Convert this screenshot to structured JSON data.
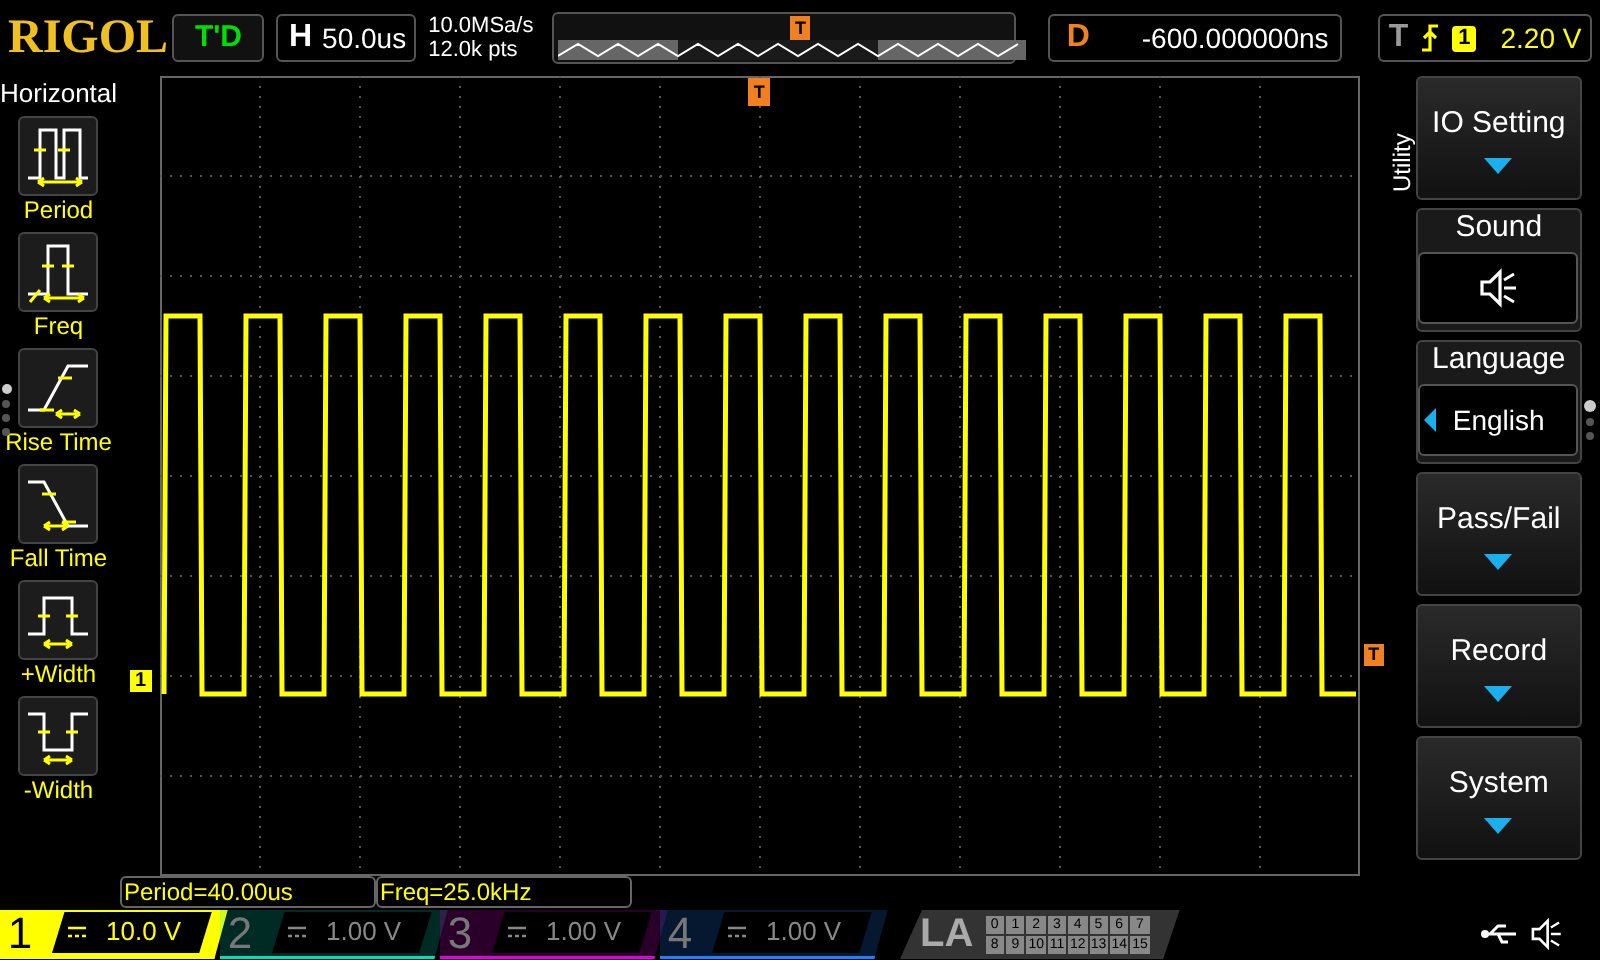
{
  "top_bar": {
    "logo": "RIGOL",
    "run_status": "T'D",
    "horizontal": {
      "label": "H",
      "value": "50.0us"
    },
    "sample_rate": "10.0MSa/s",
    "memory_depth": "12.0k pts",
    "trigger_position_marker": "T",
    "delay": {
      "label": "D",
      "value": "-600.000000ns"
    },
    "trigger": {
      "label": "T",
      "source": "1",
      "level": "2.20 V"
    }
  },
  "left_menu": {
    "title": "Horizontal",
    "items": [
      {
        "kind": "period",
        "label": "Period"
      },
      {
        "kind": "freq",
        "label": "Freq"
      },
      {
        "kind": "rise",
        "label": "Rise Time"
      },
      {
        "kind": "fall",
        "label": "Fall Time"
      },
      {
        "kind": "pwidth",
        "label": "+Width"
      },
      {
        "kind": "nwidth",
        "label": "-Width"
      }
    ],
    "pages": [
      {
        "selected": true
      },
      {
        "selected": false
      },
      {
        "selected": false
      },
      {
        "selected": false
      }
    ]
  },
  "waveform": {
    "channel_marker": "1",
    "trigger_marker_top": "T",
    "trigger_level_marker": "T"
  },
  "measurements": [
    "Period=40.00us",
    "Freq=25.0kHz"
  ],
  "right_menu": {
    "title": "Utility",
    "items": [
      {
        "kind": "submenu",
        "label": "IO Setting"
      },
      {
        "kind": "icon",
        "label": "Sound"
      },
      {
        "kind": "select",
        "label": "Language",
        "value": "English"
      },
      {
        "kind": "submenu",
        "label": "Pass/Fail"
      },
      {
        "kind": "submenu",
        "label": "Record"
      },
      {
        "kind": "submenu",
        "label": "System"
      }
    ],
    "pages": [
      {
        "selected": true
      },
      {
        "selected": false
      },
      {
        "selected": false
      }
    ]
  },
  "channels": [
    {
      "number": "1",
      "scale": "10.0 V",
      "selected": true,
      "color": "#ffff00"
    },
    {
      "number": "2",
      "scale": "1.00 V",
      "selected": false,
      "color": "#00e0c0"
    },
    {
      "number": "3",
      "scale": "1.00 V",
      "selected": false,
      "color": "#e000e0"
    },
    {
      "number": "4",
      "scale": "1.00 V",
      "selected": false,
      "color": "#2080ff"
    }
  ],
  "logic_analyzer": {
    "label": "LA",
    "digital_channels": [
      "0",
      "1",
      "2",
      "3",
      "4",
      "5",
      "6",
      "7",
      "8",
      "9",
      "10",
      "11",
      "12",
      "13",
      "14",
      "15"
    ]
  }
}
